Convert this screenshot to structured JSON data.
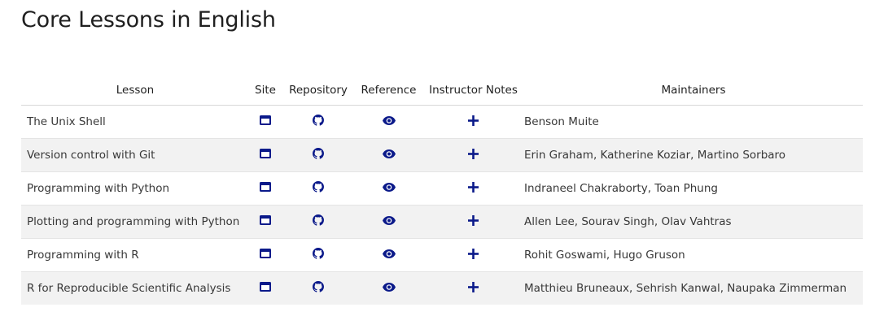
{
  "page": {
    "title": "Core Lessons in English"
  },
  "colors": {
    "icon": "#0b1a8a",
    "row_alt": "#f2f2f2",
    "text": "#383838"
  },
  "table": {
    "headers": {
      "lesson": "Lesson",
      "site": "Site",
      "repository": "Repository",
      "reference": "Reference",
      "instructor_notes": "Instructor Notes",
      "maintainers": "Maintainers"
    },
    "icons": {
      "site": "window-icon",
      "repository": "github-icon",
      "reference": "eye-icon",
      "instructor_notes": "plus-icon"
    },
    "rows": [
      {
        "lesson": "The Unix Shell",
        "maintainers": "Benson Muite"
      },
      {
        "lesson": "Version control with Git",
        "maintainers": "Erin Graham, Katherine Koziar, Martino Sorbaro"
      },
      {
        "lesson": "Programming with Python",
        "maintainers": "Indraneel Chakraborty, Toan Phung"
      },
      {
        "lesson": "Plotting and programming with Python",
        "maintainers": "Allen Lee, Sourav Singh, Olav Vahtras"
      },
      {
        "lesson": "Programming with R",
        "maintainers": "Rohit Goswami, Hugo Gruson"
      },
      {
        "lesson": "R for Reproducible Scientific Analysis",
        "maintainers": "Matthieu Bruneaux, Sehrish Kanwal, Naupaka Zimmerman"
      }
    ]
  }
}
